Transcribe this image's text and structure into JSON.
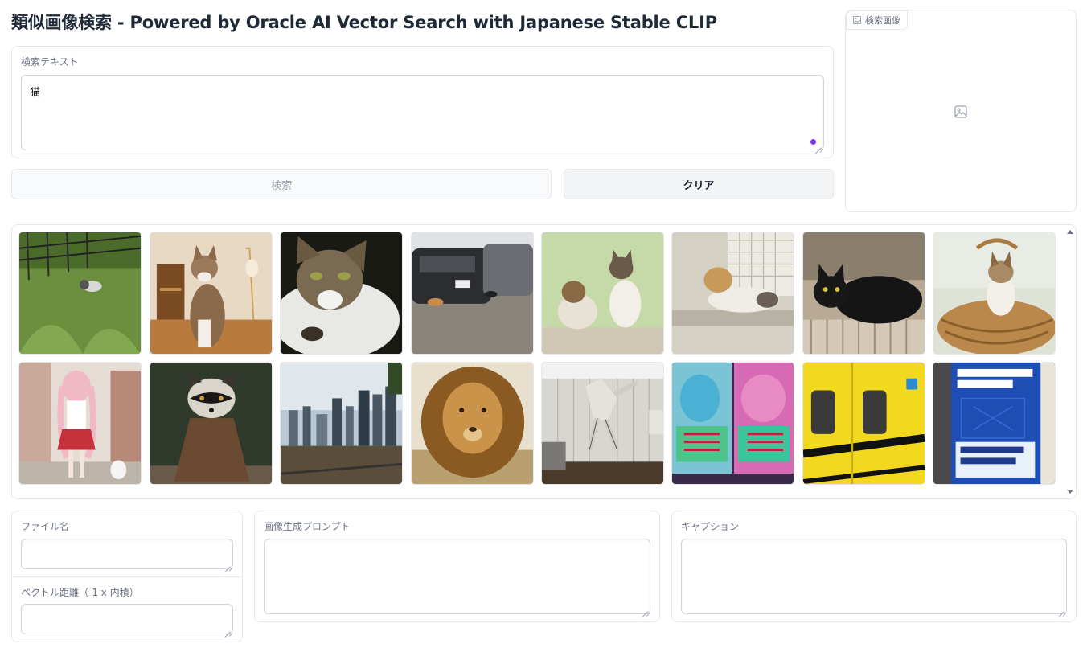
{
  "page": {
    "title": "類似画像検索 - Powered by Oracle AI Vector Search with Japanese Stable CLIP"
  },
  "search_text": {
    "label": "検索テキスト",
    "value": "猫"
  },
  "buttons": {
    "search_label": "検索",
    "clear_label": "クリア"
  },
  "search_image": {
    "label": "検索画像",
    "icon": "image-icon"
  },
  "gallery": {
    "items": [
      {
        "name": "cat-in-grass"
      },
      {
        "name": "cat-sitting-indoors"
      },
      {
        "name": "cat-closeup"
      },
      {
        "name": "cats-by-cars"
      },
      {
        "name": "two-kittens"
      },
      {
        "name": "kitten-on-window-sill"
      },
      {
        "name": "black-cat"
      },
      {
        "name": "kitten-in-basket"
      },
      {
        "name": "anime-girl-with-cat"
      },
      {
        "name": "raccoon-in-cloak"
      },
      {
        "name": "city-skyline"
      },
      {
        "name": "lion"
      },
      {
        "name": "robot-statue"
      },
      {
        "name": "manga-covers"
      },
      {
        "name": "yellow-train"
      },
      {
        "name": "blue-book-cover"
      }
    ],
    "scrollbar": true
  },
  "details": {
    "filename_label": "ファイル名",
    "filename_value": "",
    "distance_label": "ベクトル距離（-1 x 内積）",
    "distance_value": "",
    "prompt_label": "画像生成プロンプト",
    "prompt_value": "",
    "caption_label": "キャプション",
    "caption_value": ""
  },
  "colors": {
    "accent": "#7c3aed",
    "border": "#e5e7eb",
    "muted_text": "#6b7280"
  }
}
